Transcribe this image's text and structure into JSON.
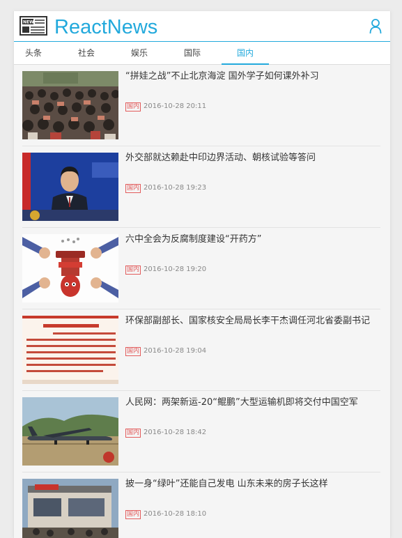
{
  "header": {
    "brand": "ReactNews",
    "logo_icon": "newspaper-icon",
    "user_icon": "user-icon",
    "accent": "#22a9dc"
  },
  "tabs": [
    {
      "label": "头条",
      "active": false
    },
    {
      "label": "社会",
      "active": false
    },
    {
      "label": "娱乐",
      "active": false
    },
    {
      "label": "国际",
      "active": false
    },
    {
      "label": "国内",
      "active": true
    }
  ],
  "news": [
    {
      "title": "“拼娃之战”不止北京海淀 国外学子如何课外补习",
      "tag": "国内",
      "time": "2016-10-28 20:11"
    },
    {
      "title": "外交部就达赖赴中印边界活动、朝核试验等答问",
      "tag": "国内",
      "time": "2016-10-28 19:23"
    },
    {
      "title": "六中全会为反腐制度建设“开药方”",
      "tag": "国内",
      "time": "2016-10-28 19:20"
    },
    {
      "title": "环保部副部长、国家核安全局局长李干杰调任河北省委副书记",
      "tag": "国内",
      "time": "2016-10-28 19:04"
    },
    {
      "title": "人民网：两架新运-20“鲲鹏”大型运输机即将交付中国空军",
      "tag": "国内",
      "time": "2016-10-28 18:42"
    },
    {
      "title": "披一身“绿叶”还能自己发电 山东未来的房子长这样",
      "tag": "国内",
      "time": "2016-10-28 18:10"
    }
  ]
}
